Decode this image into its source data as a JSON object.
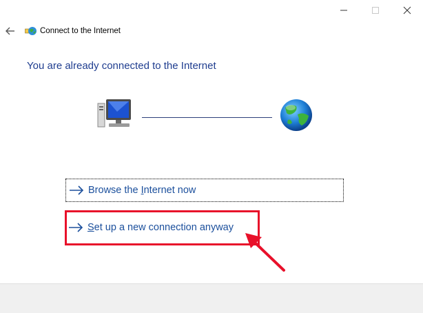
{
  "window": {
    "title": "Connect to the Internet",
    "controls": {
      "minimize_icon": "minimize-icon",
      "maximize_icon": "maximize-icon",
      "close_icon": "close-icon"
    }
  },
  "nav": {
    "back_icon": "back-arrow-icon",
    "app_icon": "network-globe-icon"
  },
  "main": {
    "headline": "You are already connected to the Internet",
    "diagram": {
      "left_icon": "computer-monitor-icon",
      "right_icon": "globe-icon"
    },
    "options": [
      {
        "label_pre": "Browse the ",
        "label_ul": "I",
        "label_post": "nternet now",
        "icon": "right-arrow-icon"
      },
      {
        "label_pre": "",
        "label_ul": "S",
        "label_post": "et up a new connection anyway",
        "icon": "right-arrow-icon"
      }
    ]
  },
  "annotation": {
    "highlight_color": "#e8102a",
    "pointer_icon": "red-pointer-arrow"
  },
  "colors": {
    "headline": "#1f3d8f",
    "link": "#1b4f9c",
    "footer_bg": "#f0f0f0"
  }
}
